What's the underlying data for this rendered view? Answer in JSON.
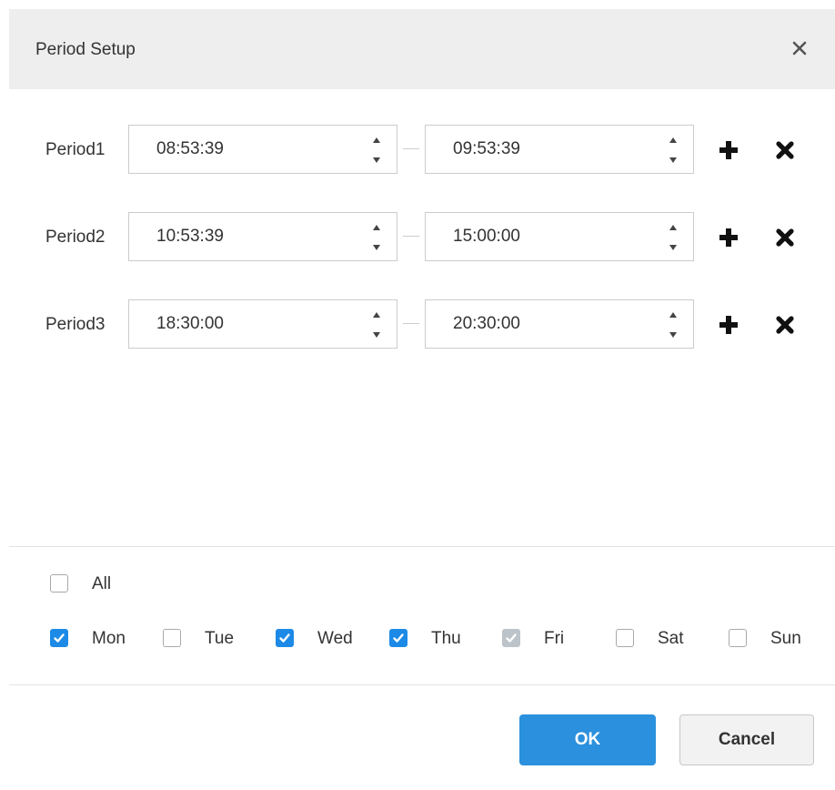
{
  "dialog": {
    "title": "Period Setup"
  },
  "periods": [
    {
      "label": "Period1",
      "start": "08:53:39",
      "end": "09:53:39"
    },
    {
      "label": "Period2",
      "start": "10:53:39",
      "end": "15:00:00"
    },
    {
      "label": "Period3",
      "start": "18:30:00",
      "end": "20:30:00"
    }
  ],
  "days": {
    "all": {
      "label": "All",
      "checked": false
    },
    "items": [
      {
        "label": "Mon",
        "state": "checked"
      },
      {
        "label": "Tue",
        "state": "unchecked"
      },
      {
        "label": "Wed",
        "state": "checked"
      },
      {
        "label": "Thu",
        "state": "checked"
      },
      {
        "label": "Fri",
        "state": "checked-disabled"
      },
      {
        "label": "Sat",
        "state": "unchecked"
      },
      {
        "label": "Sun",
        "state": "unchecked"
      }
    ]
  },
  "buttons": {
    "ok_label": "OK",
    "cancel_label": "Cancel"
  },
  "colors": {
    "accent": "#2b90dd",
    "checkbox_checked": "#1c8ae6",
    "checkbox_disabled": "#bcc3c9",
    "header_bg": "#eeeeee"
  },
  "icons": {
    "close": "close-icon",
    "spin_up": "caret-up-icon",
    "spin_down": "caret-down-icon",
    "add": "plus-icon",
    "remove": "x-icon",
    "check": "checkmark-icon"
  }
}
